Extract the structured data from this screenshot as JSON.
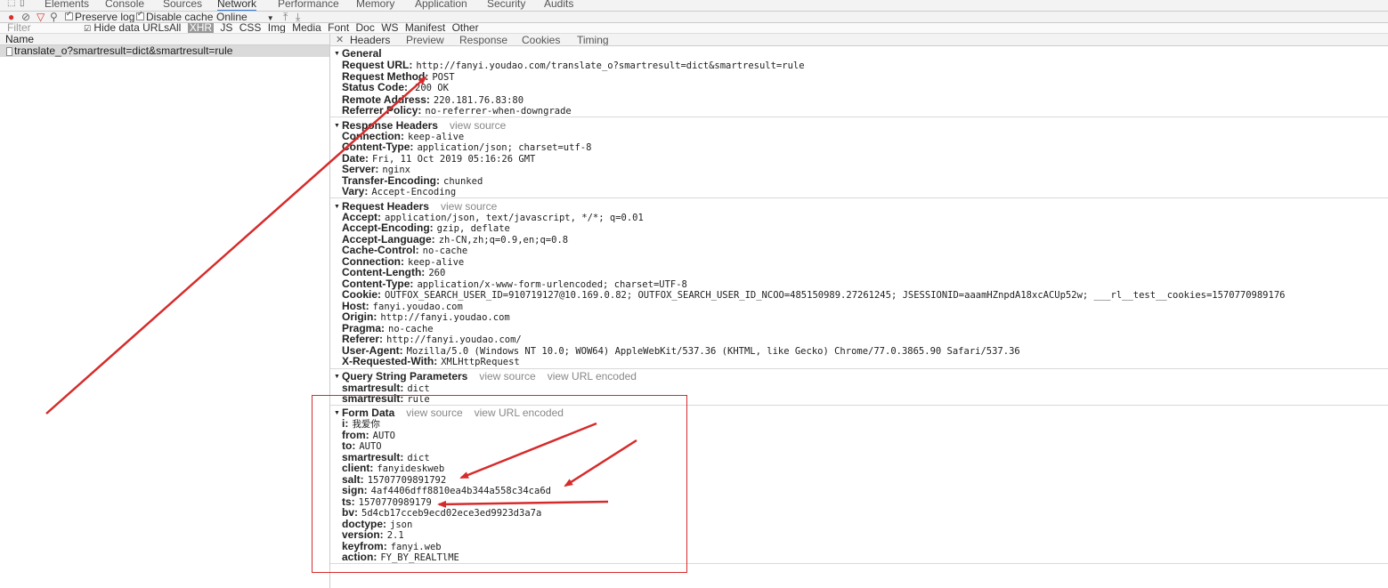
{
  "devtools": {
    "tabs": [
      "Elements",
      "Console",
      "Sources",
      "Network",
      "Performance",
      "Memory",
      "Application",
      "Security",
      "Audits"
    ],
    "active_tab": "Network"
  },
  "toolbar": {
    "preserve_log": "Preserve log",
    "disable_cache": "Disable cache",
    "throttle": "Online"
  },
  "filter": {
    "placeholder": "Filter",
    "hide_data_urls": "Hide data URLs",
    "types": [
      "All",
      "XHR",
      "JS",
      "CSS",
      "Img",
      "Media",
      "Font",
      "Doc",
      "WS",
      "Manifest",
      "Other"
    ],
    "selected_type": "XHR"
  },
  "request_list": {
    "column_name": "Name",
    "items": [
      "translate_o?smartresult=dict&smartresult=rule"
    ]
  },
  "detail_tabs": [
    "Headers",
    "Preview",
    "Response",
    "Cookies",
    "Timing"
  ],
  "general": {
    "title": "General",
    "rows": [
      {
        "k": "Request URL:",
        "v": "http://fanyi.youdao.com/translate_o?smartresult=dict&smartresult=rule"
      },
      {
        "k": "Request Method:",
        "v": "POST"
      },
      {
        "k": "Status Code:",
        "v": "200 OK"
      },
      {
        "k": "Remote Address:",
        "v": "220.181.76.83:80"
      },
      {
        "k": "Referrer Policy:",
        "v": "no-referrer-when-downgrade"
      }
    ]
  },
  "response_headers": {
    "title": "Response Headers",
    "link": "view source",
    "rows": [
      {
        "k": "Connection:",
        "v": "keep-alive"
      },
      {
        "k": "Content-Type:",
        "v": "application/json; charset=utf-8"
      },
      {
        "k": "Date:",
        "v": "Fri, 11 Oct 2019 05:16:26 GMT"
      },
      {
        "k": "Server:",
        "v": "nginx"
      },
      {
        "k": "Transfer-Encoding:",
        "v": "chunked"
      },
      {
        "k": "Vary:",
        "v": "Accept-Encoding"
      }
    ]
  },
  "request_headers": {
    "title": "Request Headers",
    "link": "view source",
    "rows": [
      {
        "k": "Accept:",
        "v": "application/json, text/javascript, */*; q=0.01"
      },
      {
        "k": "Accept-Encoding:",
        "v": "gzip, deflate"
      },
      {
        "k": "Accept-Language:",
        "v": "zh-CN,zh;q=0.9,en;q=0.8"
      },
      {
        "k": "Cache-Control:",
        "v": "no-cache"
      },
      {
        "k": "Connection:",
        "v": "keep-alive"
      },
      {
        "k": "Content-Length:",
        "v": "260"
      },
      {
        "k": "Content-Type:",
        "v": "application/x-www-form-urlencoded; charset=UTF-8"
      },
      {
        "k": "Cookie:",
        "v": "OUTFOX_SEARCH_USER_ID=910719127@10.169.0.82; OUTFOX_SEARCH_USER_ID_NCOO=485150989.27261245; JSESSIONID=aaamHZnpdA18xcACUp52w; ___rl__test__cookies=1570770989176"
      },
      {
        "k": "Host:",
        "v": "fanyi.youdao.com"
      },
      {
        "k": "Origin:",
        "v": "http://fanyi.youdao.com"
      },
      {
        "k": "Pragma:",
        "v": "no-cache"
      },
      {
        "k": "Referer:",
        "v": "http://fanyi.youdao.com/"
      },
      {
        "k": "User-Agent:",
        "v": "Mozilla/5.0 (Windows NT 10.0; WOW64) AppleWebKit/537.36 (KHTML, like Gecko) Chrome/77.0.3865.90 Safari/537.36"
      },
      {
        "k": "X-Requested-With:",
        "v": "XMLHttpRequest"
      }
    ]
  },
  "query_params": {
    "title": "Query String Parameters",
    "link1": "view source",
    "link2": "view URL encoded",
    "rows": [
      {
        "k": "smartresult:",
        "v": "dict"
      },
      {
        "k": "smartresult:",
        "v": "rule"
      }
    ]
  },
  "form_data": {
    "title": "Form Data",
    "link1": "view source",
    "link2": "view URL encoded",
    "rows": [
      {
        "k": "i:",
        "v": "我爱你"
      },
      {
        "k": "from:",
        "v": "AUTO"
      },
      {
        "k": "to:",
        "v": "AUTO"
      },
      {
        "k": "smartresult:",
        "v": "dict"
      },
      {
        "k": "client:",
        "v": "fanyideskweb"
      },
      {
        "k": "salt:",
        "v": "15707709891792"
      },
      {
        "k": "sign:",
        "v": "4af4406dff8810ea4b344a558c34ca6d"
      },
      {
        "k": "ts:",
        "v": "1570770989179"
      },
      {
        "k": "bv:",
        "v": "5d4cb17cceb9ecd02ece3ed9923d3a7a"
      },
      {
        "k": "doctype:",
        "v": "json"
      },
      {
        "k": "version:",
        "v": "2.1"
      },
      {
        "k": "keyfrom:",
        "v": "fanyi.web"
      },
      {
        "k": "action:",
        "v": "FY_BY_REALTlME"
      }
    ]
  },
  "annotation_color": "#d62b2b"
}
